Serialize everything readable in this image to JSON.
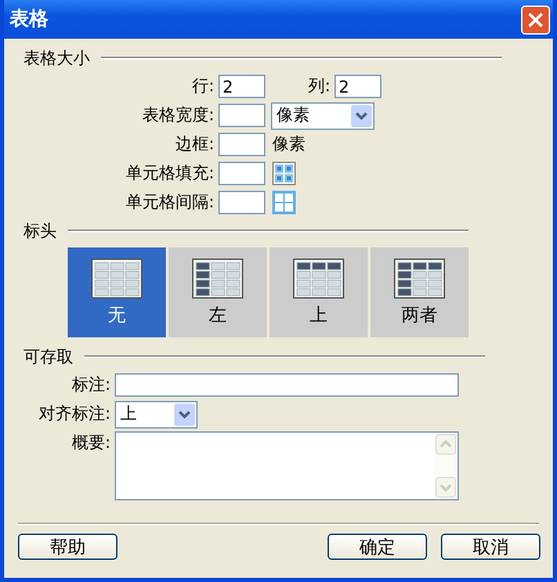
{
  "window": {
    "title": "表格"
  },
  "table_size": {
    "heading": "表格大小",
    "rows": {
      "label": "行:",
      "value": "2"
    },
    "columns": {
      "label": "列:",
      "value": "2"
    },
    "width": {
      "label": "表格宽度:",
      "unit": "像素"
    },
    "border": {
      "label": "边框:",
      "unit": "像素"
    },
    "cell_padding": {
      "label": "单元格填充:"
    },
    "cell_spacing": {
      "label": "单元格间隔:"
    }
  },
  "header": {
    "heading": "标头",
    "options": [
      {
        "label": "无",
        "kind": "none",
        "selected": true
      },
      {
        "label": "左",
        "kind": "left",
        "selected": false
      },
      {
        "label": "上",
        "kind": "top",
        "selected": false
      },
      {
        "label": "两者",
        "kind": "both",
        "selected": false
      }
    ]
  },
  "accessibility": {
    "heading": "可存取",
    "caption": {
      "label": "标注:"
    },
    "align_caption": {
      "label": "对齐标注:",
      "value": "上"
    },
    "summary": {
      "label": "概要:"
    }
  },
  "buttons": [
    {
      "label": "帮助"
    },
    {
      "label": "确定"
    },
    {
      "label": "取消"
    }
  ]
}
